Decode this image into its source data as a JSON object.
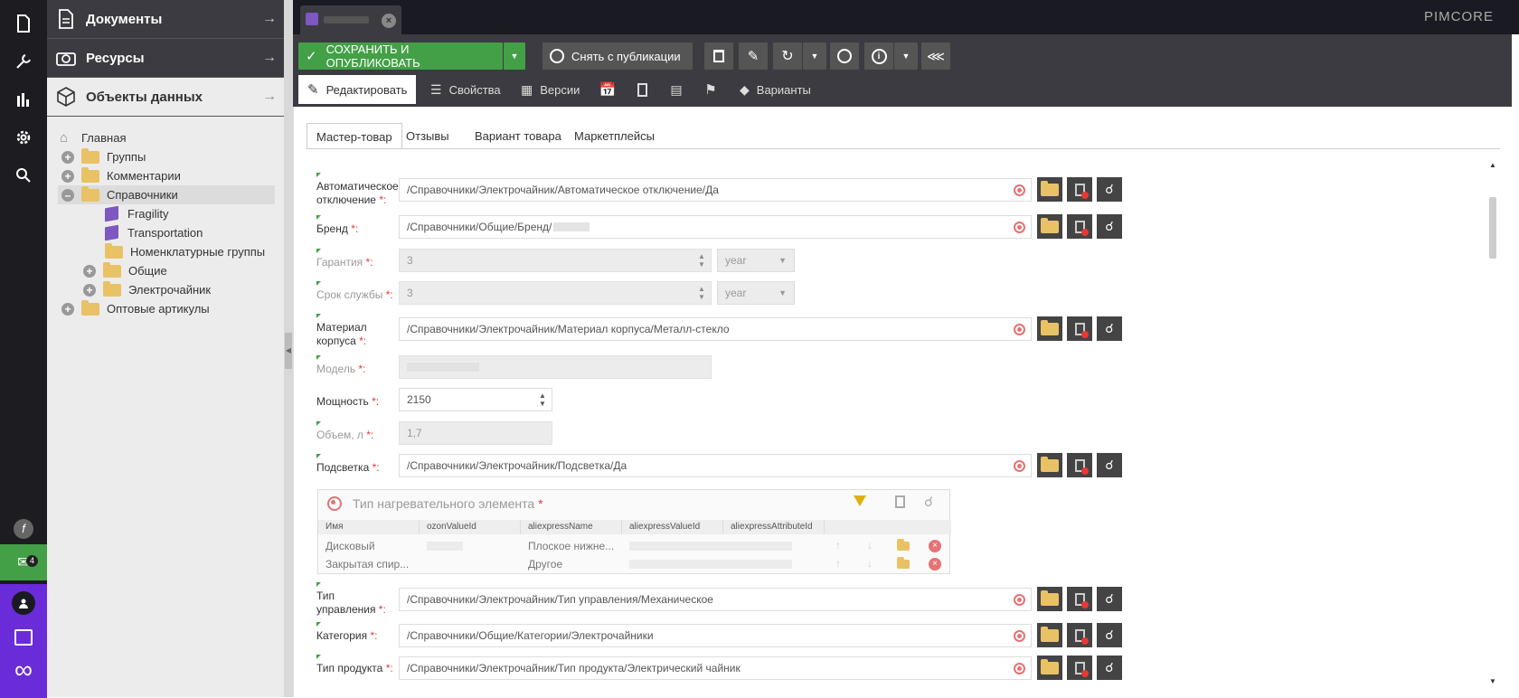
{
  "left_nav": {
    "items": [
      "document-icon",
      "wrench-icon",
      "chart-icon",
      "gear-icon",
      "search-icon"
    ],
    "notif_count": "4"
  },
  "tree": {
    "accordions": [
      {
        "label": "Документы"
      },
      {
        "label": "Ресурсы"
      },
      {
        "label": "Объекты данных"
      }
    ],
    "nodes": {
      "home": "Главная",
      "groups": "Группы",
      "comments": "Комментарии",
      "refs": "Справочники",
      "fragility": "Fragility",
      "transportation": "Transportation",
      "nomen": "Номенклатурные группы",
      "common": "Общие",
      "electro": "Электрочайник",
      "wholesale": "Оптовые артикулы"
    }
  },
  "topbar": {
    "logo": "PIMCORE"
  },
  "toolbar": {
    "save_publish": "СОХРАНИТЬ И ОПУБЛИКОВАТЬ",
    "unpublish": "Снять с публикации",
    "tabs": {
      "edit": "Редактировать",
      "properties": "Свойства",
      "versions": "Версии",
      "variants": "Варианты"
    }
  },
  "subtabs": [
    "Мастер-товар",
    "Отзывы",
    "Вариант товара",
    "Маркетплейсы"
  ],
  "fields": {
    "auto_off": {
      "label1": "Автоматическое",
      "label2": "отключение",
      "value": "/Справочники/Электрочайник/Автоматическое отключение/Да"
    },
    "brand": {
      "label": "Бренд",
      "value": "/Справочники/Общие/Бренд/"
    },
    "warranty": {
      "label": "Гарантия",
      "value": "3",
      "unit": "year"
    },
    "lifetime": {
      "label": "Срок службы",
      "value": "3",
      "unit": "year"
    },
    "material": {
      "label1": "Материал",
      "label2": "корпуса",
      "value": "/Справочники/Электрочайник/Материал корпуса/Металл-стекло"
    },
    "model": {
      "label": "Модель"
    },
    "power": {
      "label": "Мощность",
      "value": "2150"
    },
    "volume": {
      "label": "Объем, л",
      "value": "1,7"
    },
    "backlight": {
      "label": "Подсветка",
      "value": "/Справочники/Электрочайник/Подсветка/Да"
    },
    "control": {
      "label1": "Тип",
      "label2": "управления",
      "value": "/Справочники/Электрочайник/Тип управления/Механическое"
    },
    "category": {
      "label": "Категория",
      "value": "/Справочники/Общие/Категории/Электрочайники"
    },
    "product_type": {
      "label": "Тип продукта",
      "value": "/Справочники/Электрочайник/Тип продукта/Электрический чайник"
    }
  },
  "req_mark": "*:",
  "grid": {
    "title": "Тип нагревательного элемента",
    "headers": [
      "Имя",
      "ozonValueId",
      "aliexpressName",
      "aliexpressValueId",
      "aliexpressAttributeId"
    ],
    "rows": [
      {
        "name": "Дисковый",
        "ali_name": "Плоское нижне..."
      },
      {
        "name": "Закрытая спир...",
        "ali_name": "Другое"
      }
    ]
  },
  "colors": {
    "accent_green": "#43a047",
    "dark": "#3b3b41",
    "required": "#e53935"
  }
}
